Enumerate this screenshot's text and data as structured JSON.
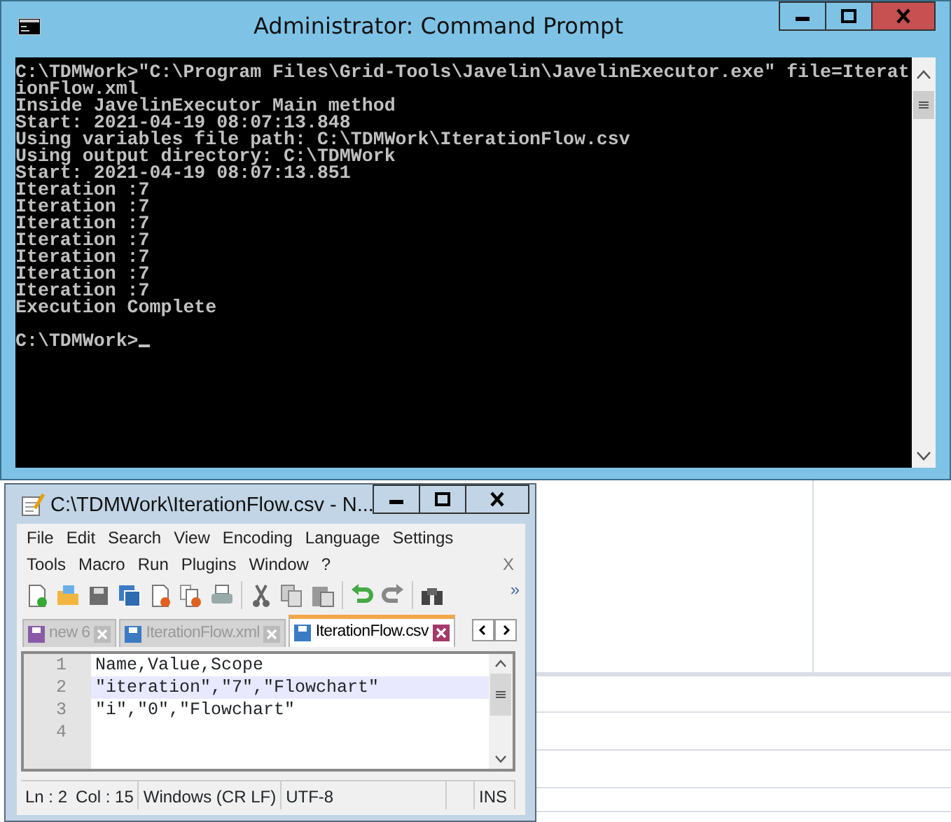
{
  "console_window": {
    "title": "Administrator: Command Prompt",
    "lines": [
      {
        "text": "C:\\TDMWork>\"C:\\Program Files\\Grid-Tools\\Javelin\\JavelinExecutor.exe\" file=Iterat"
      },
      {
        "text": "ionFlow.xml"
      },
      {
        "text": "Inside JavelinExecutor Main method"
      },
      {
        "text": "Start: 2021-04-19 08:07:13.848"
      },
      {
        "text": "Using variables file path: C:\\TDMWork\\IterationFlow.csv"
      },
      {
        "text": "Using output directory: C:\\TDMWork"
      },
      {
        "text": "Start: 2021-04-19 08:07:13.851"
      },
      {
        "text": "Iteration :7"
      },
      {
        "text": "Iteration :7"
      },
      {
        "text": "Iteration :7"
      },
      {
        "text": "Iteration :7"
      },
      {
        "text": "Iteration :7"
      },
      {
        "text": "Iteration :7"
      },
      {
        "text": "Iteration :7"
      },
      {
        "text": "Execution Complete"
      },
      {
        "text": "C:\\TDMWork>",
        "blank_line_before": true
      }
    ],
    "cursor": true
  },
  "editor_window": {
    "title": "C:\\TDMWork\\IterationFlow.csv - N...",
    "menu_rows": [
      [
        "File",
        "Edit",
        "Search",
        "View",
        "Encoding",
        "Language",
        "Settings"
      ],
      [
        "Tools",
        "Macro",
        "Run",
        "Plugins",
        "Window",
        "?"
      ]
    ],
    "menu_close": "X",
    "toolbar_overflow": "»",
    "tabs": [
      {
        "label": "new 6",
        "selected": false,
        "modified": true
      },
      {
        "label": "IterationFlow.xml",
        "selected": false,
        "modified": false
      },
      {
        "label": "IterationFlow.csv",
        "selected": true,
        "modified": false
      }
    ],
    "lines": [
      {
        "number": "1",
        "text": "Name,Value,Scope",
        "current": false
      },
      {
        "number": "2",
        "text": "\"iteration\",\"7\",\"Flowchart\"",
        "current": true
      },
      {
        "number": "3",
        "text": "\"i\",\"0\",\"Flowchart\"",
        "current": false
      },
      {
        "number": "4",
        "current": false
      }
    ],
    "status_bar": [
      "Ln : 2",
      "Col : 15",
      "Windows (CR LF)",
      "UTF-8",
      "INS"
    ]
  }
}
